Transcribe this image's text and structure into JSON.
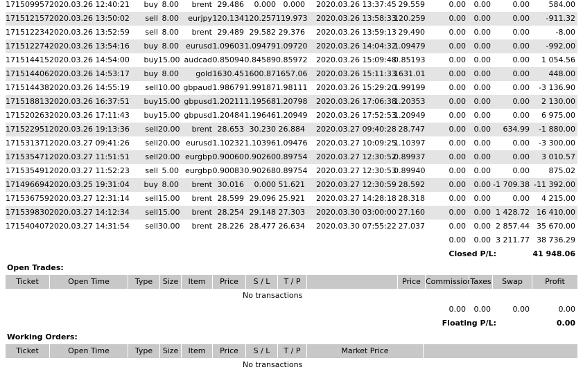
{
  "closed_trades": [
    {
      "ticket": "171509957",
      "open_time": "2020.03.26 12:40:21",
      "type": "buy",
      "size": "8.00",
      "item": "brent",
      "price": "29.486",
      "sl": "0.000",
      "tp": "0.000",
      "close_time": "2020.03.26 13:37:45",
      "close_price": "29.559",
      "commission": "0.00",
      "taxes": "0.00",
      "swap": "0.00",
      "profit": "584.00"
    },
    {
      "ticket": "171512157",
      "open_time": "2020.03.26 13:50:02",
      "type": "sell",
      "size": "8.00",
      "item": "eurjpy",
      "price": "120.134",
      "sl": "120.257",
      "tp": "119.973",
      "close_time": "2020.03.26 13:58:33",
      "close_price": "120.259",
      "commission": "0.00",
      "taxes": "0.00",
      "swap": "0.00",
      "profit": "-911.32"
    },
    {
      "ticket": "171512234",
      "open_time": "2020.03.26 13:52:59",
      "type": "sell",
      "size": "8.00",
      "item": "brent",
      "price": "29.489",
      "sl": "29.582",
      "tp": "29.376",
      "close_time": "2020.03.26 13:59:13",
      "close_price": "29.490",
      "commission": "0.00",
      "taxes": "0.00",
      "swap": "0.00",
      "profit": "-8.00"
    },
    {
      "ticket": "171512274",
      "open_time": "2020.03.26 13:54:16",
      "type": "buy",
      "size": "8.00",
      "item": "eurusd",
      "price": "1.09603",
      "sl": "1.09479",
      "tp": "1.09720",
      "close_time": "2020.03.26 14:04:32",
      "close_price": "1.09479",
      "commission": "0.00",
      "taxes": "0.00",
      "swap": "0.00",
      "profit": "-992.00"
    },
    {
      "ticket": "171514415",
      "open_time": "2020.03.26 14:54:00",
      "type": "buy",
      "size": "15.00",
      "item": "audcad",
      "price": "0.85094",
      "sl": "0.84589",
      "tp": "0.85972",
      "close_time": "2020.03.26 15:09:48",
      "close_price": "0.85193",
      "commission": "0.00",
      "taxes": "0.00",
      "swap": "0.00",
      "profit": "1 054.56"
    },
    {
      "ticket": "171514406",
      "open_time": "2020.03.26 14:53:17",
      "type": "buy",
      "size": "8.00",
      "item": "gold",
      "price": "1630.45",
      "sl": "1600.87",
      "tp": "1657.06",
      "close_time": "2020.03.26 15:11:33",
      "close_price": "1631.01",
      "commission": "0.00",
      "taxes": "0.00",
      "swap": "0.00",
      "profit": "448.00"
    },
    {
      "ticket": "171514438",
      "open_time": "2020.03.26 14:55:19",
      "type": "sell",
      "size": "10.00",
      "item": "gbpaud",
      "price": "1.98679",
      "sl": "1.99187",
      "tp": "1.98111",
      "close_time": "2020.03.26 15:29:20",
      "close_price": "1.99199",
      "commission": "0.00",
      "taxes": "0.00",
      "swap": "0.00",
      "profit": "-3 136.90"
    },
    {
      "ticket": "171518813",
      "open_time": "2020.03.26 16:37:51",
      "type": "buy",
      "size": "15.00",
      "item": "gbpusd",
      "price": "1.20211",
      "sl": "1.19568",
      "tp": "1.20798",
      "close_time": "2020.03.26 17:06:38",
      "close_price": "1.20353",
      "commission": "0.00",
      "taxes": "0.00",
      "swap": "0.00",
      "profit": "2 130.00"
    },
    {
      "ticket": "171520263",
      "open_time": "2020.03.26 17:11:43",
      "type": "buy",
      "size": "15.00",
      "item": "gbpusd",
      "price": "1.20484",
      "sl": "1.19646",
      "tp": "1.20949",
      "close_time": "2020.03.26 17:52:53",
      "close_price": "1.20949",
      "commission": "0.00",
      "taxes": "0.00",
      "swap": "0.00",
      "profit": "6 975.00"
    },
    {
      "ticket": "171522951",
      "open_time": "2020.03.26 19:13:36",
      "type": "sell",
      "size": "20.00",
      "item": "brent",
      "price": "28.653",
      "sl": "30.230",
      "tp": "26.884",
      "close_time": "2020.03.27 09:40:28",
      "close_price": "28.747",
      "commission": "0.00",
      "taxes": "0.00",
      "swap": "634.99",
      "profit": "-1 880.00"
    },
    {
      "ticket": "171531371",
      "open_time": "2020.03.27 09:41:26",
      "type": "sell",
      "size": "20.00",
      "item": "eurusd",
      "price": "1.10232",
      "sl": "1.10396",
      "tp": "1.09476",
      "close_time": "2020.03.27 10:09:25",
      "close_price": "1.10397",
      "commission": "0.00",
      "taxes": "0.00",
      "swap": "0.00",
      "profit": "-3 300.00"
    },
    {
      "ticket": "171535471",
      "open_time": "2020.03.27 11:51:51",
      "type": "sell",
      "size": "20.00",
      "item": "eurgbp",
      "price": "0.90060",
      "sl": "0.90260",
      "tp": "0.89754",
      "close_time": "2020.03.27 12:30:52",
      "close_price": "0.89937",
      "commission": "0.00",
      "taxes": "0.00",
      "swap": "0.00",
      "profit": "3 010.57"
    },
    {
      "ticket": "171535491",
      "open_time": "2020.03.27 11:52:23",
      "type": "sell",
      "size": "5.00",
      "item": "eurgbp",
      "price": "0.90083",
      "sl": "0.90268",
      "tp": "0.89754",
      "close_time": "2020.03.27 12:30:53",
      "close_price": "0.89940",
      "commission": "0.00",
      "taxes": "0.00",
      "swap": "0.00",
      "profit": "875.02"
    },
    {
      "ticket": "171496694",
      "open_time": "2020.03.25 19:31:04",
      "type": "buy",
      "size": "8.00",
      "item": "brent",
      "price": "30.016",
      "sl": "0.000",
      "tp": "51.621",
      "close_time": "2020.03.27 12:30:59",
      "close_price": "28.592",
      "commission": "0.00",
      "taxes": "0.00",
      "swap": "-1 709.38",
      "profit": "-11 392.00"
    },
    {
      "ticket": "171536759",
      "open_time": "2020.03.27 12:31:14",
      "type": "sell",
      "size": "15.00",
      "item": "brent",
      "price": "28.599",
      "sl": "29.096",
      "tp": "25.921",
      "close_time": "2020.03.27 14:28:18",
      "close_price": "28.318",
      "commission": "0.00",
      "taxes": "0.00",
      "swap": "0.00",
      "profit": "4 215.00"
    },
    {
      "ticket": "171539830",
      "open_time": "2020.03.27 14:12:34",
      "type": "sell",
      "size": "15.00",
      "item": "brent",
      "price": "28.254",
      "sl": "29.148",
      "tp": "27.303",
      "close_time": "2020.03.30 03:00:00",
      "close_price": "27.160",
      "commission": "0.00",
      "taxes": "0.00",
      "swap": "1 428.72",
      "profit": "16 410.00"
    },
    {
      "ticket": "171540407",
      "open_time": "2020.03.27 14:31:54",
      "type": "sell",
      "size": "30.00",
      "item": "brent",
      "price": "28.226",
      "sl": "28.477",
      "tp": "26.634",
      "close_time": "2020.03.30 07:55:22",
      "close_price": "27.037",
      "commission": "0.00",
      "taxes": "0.00",
      "swap": "2 857.44",
      "profit": "35 670.00"
    }
  ],
  "closed_totals": {
    "commission": "0.00",
    "taxes": "0.00",
    "swap": "3 211.77",
    "profit": "38 736.29"
  },
  "closed_pl": {
    "label": "Closed P/L:",
    "value": "41 948.06"
  },
  "open_trades": {
    "title": "Open Trades:",
    "headers": {
      "ticket": "Ticket",
      "open_time": "Open Time",
      "type": "Type",
      "size": "Size",
      "item": "Item",
      "price": "Price",
      "sl": "S / L",
      "tp": "T / P",
      "price2": "Price",
      "commission": "Commission",
      "taxes": "Taxes",
      "swap": "Swap",
      "profit": "Profit"
    },
    "message": "No transactions",
    "totals": {
      "commission": "0.00",
      "taxes": "0.00",
      "swap": "0.00",
      "profit": "0.00"
    },
    "floating_label": "Floating P/L:",
    "floating_value": "0.00"
  },
  "working_orders": {
    "title": "Working Orders:",
    "headers": {
      "ticket": "Ticket",
      "open_time": "Open Time",
      "type": "Type",
      "size": "Size",
      "item": "Item",
      "price": "Price",
      "sl": "S / L",
      "tp": "T / P",
      "market_price": "Market Price"
    },
    "message": "No transactions"
  }
}
